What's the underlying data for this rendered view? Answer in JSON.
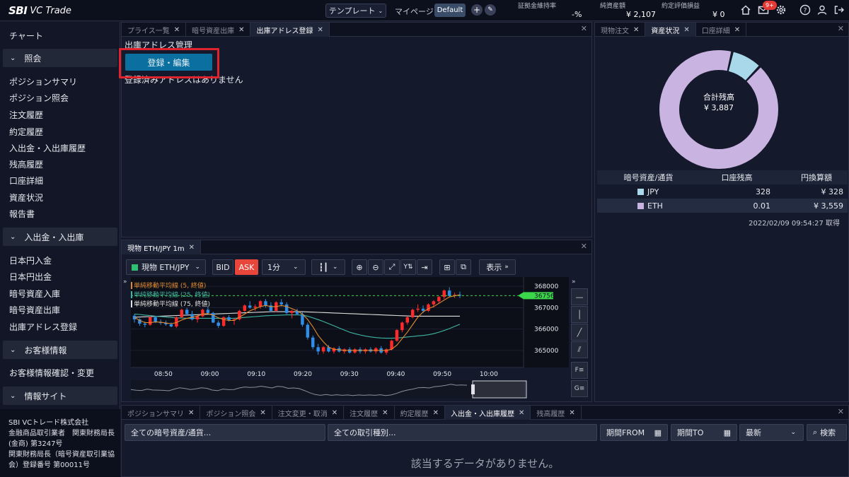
{
  "header": {
    "logo_sbi": "SBI",
    "logo_vc": "VC Trade",
    "template_label": "テンプレート",
    "mypage_label": "マイページ:",
    "default_label": "Default",
    "stats": [
      {
        "label": "証拠金維持率",
        "value": "-%"
      },
      {
        "label": "純資産額",
        "value": "¥ 2,107"
      },
      {
        "label": "約定評価損益",
        "value": "¥ 0"
      }
    ],
    "notif_badge": "9+"
  },
  "sidebar": {
    "chart_item": "チャート",
    "sections": [
      {
        "label": "照会",
        "items": [
          "ポジションサマリ",
          "ポジション照会",
          "注文履歴",
          "約定履歴",
          "入出金・入出庫履歴",
          "残高履歴",
          "口座詳細",
          "資産状況",
          "報告書"
        ]
      },
      {
        "label": "入出金・入出庫",
        "items": [
          "日本円入金",
          "日本円出金",
          "暗号資産入庫",
          "暗号資産出庫",
          "出庫アドレス登録"
        ]
      },
      {
        "label": "お客様情報",
        "items": [
          "お客様情報確認・変更"
        ]
      },
      {
        "label": "情報サイト",
        "items": []
      }
    ],
    "footer": [
      "SBI VCトレード株式会社",
      "金融商品取引業者　関東財務局長",
      "(金商) 第3247号",
      "関東財務局長（暗号資産取引業協",
      "会）登録番号 第00011号"
    ]
  },
  "top_panel": {
    "tabs": [
      {
        "label": "プライス一覧",
        "active": false
      },
      {
        "label": "暗号資産出庫",
        "active": false
      },
      {
        "label": "出庫アドレス登録",
        "active": true
      }
    ],
    "title": "出庫アドレス管理",
    "button": "登録・編集",
    "empty": "登録済みアドレスはありません"
  },
  "chart_panel": {
    "tab": "現物 ETH/JPY 1m",
    "symbol": "現物 ETH/JPY",
    "bid": "BID",
    "ask": "ASK",
    "interval": "1分",
    "display": "表示",
    "last_price": "367560",
    "legend": [
      "単純移動平均線 (5, 終値)",
      "単純移動平均線 (25, 終値)",
      "単純移動平均線 (75, 終値)"
    ],
    "legend_colors": [
      "#e08a2e",
      "#3fb5a3",
      "#e0e0e0"
    ]
  },
  "chart_data": {
    "type": "candlestick",
    "symbol": "ETH/JPY",
    "x_ticks": [
      "08:50",
      "09:00",
      "09:10",
      "09:20",
      "09:30",
      "09:40",
      "09:50",
      "10:00"
    ],
    "y_ticks": [
      368000,
      367000,
      366000,
      365000
    ],
    "ylim": [
      364300,
      368300
    ],
    "last_price": 367560,
    "candles": [
      [
        366620,
        366700,
        366300,
        366450
      ],
      [
        366450,
        366500,
        366150,
        366250
      ],
      [
        366250,
        366350,
        366080,
        366200
      ],
      [
        366200,
        366600,
        366150,
        366550
      ],
      [
        366550,
        366620,
        366280,
        366320
      ],
      [
        366320,
        366450,
        366200,
        366280
      ],
      [
        366280,
        366400,
        366150,
        366220
      ],
      [
        366220,
        366300,
        366080,
        366120
      ],
      [
        366120,
        366600,
        366050,
        366550
      ],
      [
        366550,
        366950,
        366500,
        366900
      ],
      [
        366900,
        367000,
        366650,
        366700
      ],
      [
        366700,
        366850,
        366400,
        366450
      ],
      [
        366450,
        366650,
        366300,
        366600
      ],
      [
        366600,
        366950,
        366550,
        366900
      ],
      [
        366900,
        367050,
        366700,
        366750
      ],
      [
        366750,
        366800,
        366280,
        366300
      ],
      [
        366300,
        366400,
        366050,
        366150
      ],
      [
        366150,
        366600,
        366100,
        366550
      ],
      [
        366550,
        366650,
        366350,
        366400
      ],
      [
        366400,
        366500,
        366200,
        366450
      ],
      [
        366450,
        366900,
        366400,
        366850
      ],
      [
        366850,
        367150,
        366800,
        367100
      ],
      [
        367100,
        367300,
        366950,
        367000
      ],
      [
        367000,
        367150,
        366850,
        367050
      ],
      [
        367050,
        367350,
        366950,
        367300
      ],
      [
        367300,
        367400,
        367000,
        367100
      ],
      [
        367100,
        367250,
        366800,
        366850
      ],
      [
        366850,
        367300,
        366800,
        367250
      ],
      [
        367250,
        367400,
        367050,
        367150
      ],
      [
        367150,
        367250,
        366700,
        366750
      ],
      [
        366750,
        366900,
        366500,
        366850
      ],
      [
        366850,
        366950,
        366650,
        366700
      ],
      [
        366700,
        366800,
        366100,
        366200
      ],
      [
        366200,
        366300,
        365500,
        365600
      ],
      [
        365600,
        365700,
        365050,
        365150
      ],
      [
        365150,
        365300,
        364800,
        364950
      ],
      [
        364950,
        365200,
        364850,
        365150
      ],
      [
        365150,
        365250,
        364900,
        364950
      ],
      [
        364950,
        365150,
        364850,
        365100
      ],
      [
        365100,
        365200,
        364900,
        364950
      ],
      [
        364950,
        365100,
        364850,
        365050
      ],
      [
        365050,
        365150,
        364850,
        364900
      ],
      [
        364900,
        365100,
        364850,
        365050
      ],
      [
        365050,
        365150,
        364850,
        364950
      ],
      [
        364950,
        365100,
        364850,
        365050
      ],
      [
        365050,
        365150,
        364900,
        364950
      ],
      [
        364950,
        365150,
        364850,
        365100
      ],
      [
        365100,
        365200,
        364850,
        364900
      ],
      [
        364900,
        365100,
        364800,
        365050
      ],
      [
        365050,
        365500,
        365000,
        365450
      ],
      [
        365450,
        366000,
        365400,
        365950
      ],
      [
        365950,
        366350,
        365850,
        366300
      ],
      [
        366300,
        366600,
        366200,
        366550
      ],
      [
        366550,
        366950,
        366500,
        366900
      ],
      [
        366900,
        367150,
        366800,
        366950
      ],
      [
        366950,
        367100,
        366750,
        366850
      ],
      [
        366850,
        367200,
        366800,
        367150
      ],
      [
        367150,
        367350,
        367000,
        367300
      ],
      [
        367300,
        367550,
        367200,
        367500
      ],
      [
        367500,
        367850,
        367400,
        367800
      ],
      [
        367800,
        367950,
        367500,
        367550
      ],
      [
        367550,
        367700,
        367450,
        367600
      ],
      [
        367600,
        367750,
        367450,
        367560
      ]
    ],
    "sma5": [
      366550,
      366400,
      366300,
      366300,
      366330,
      366320,
      366280,
      366250,
      366300,
      366420,
      366500,
      366550,
      366600,
      366700,
      366720,
      366650,
      366520,
      366450,
      366400,
      366400,
      366550,
      366700,
      366850,
      366950,
      367050,
      367100,
      367050,
      367050,
      367100,
      367050,
      366950,
      366850,
      366700,
      366450,
      366100,
      365700,
      365400,
      365150,
      365050,
      365030,
      365000,
      365000,
      365000,
      365000,
      365000,
      365000,
      365000,
      365000,
      365000,
      365050,
      365250,
      365550,
      365850,
      366200,
      366550,
      366800,
      366950,
      367050,
      367200,
      367350,
      367500,
      367550,
      367600
    ],
    "sma25": [
      366700,
      366680,
      366650,
      366630,
      366600,
      366580,
      366560,
      366540,
      366520,
      366510,
      366500,
      366500,
      366500,
      366500,
      366500,
      366500,
      366500,
      366500,
      366500,
      366500,
      366520,
      366540,
      366560,
      366580,
      366600,
      366620,
      366630,
      366640,
      366650,
      366660,
      366660,
      366660,
      366650,
      366600,
      366520,
      366440,
      366350,
      366250,
      366150,
      366050,
      365950,
      365850,
      365780,
      365720,
      365670,
      365630,
      365600,
      365580,
      365570,
      365570,
      365580,
      365600,
      365630,
      365650,
      365680,
      365700,
      365730,
      365780,
      365850,
      365930,
      366020,
      366120,
      366220
    ],
    "sma75": [
      366550,
      366560,
      366570,
      366580,
      366590,
      366600,
      366610,
      366620,
      366630,
      366640,
      366650,
      366660,
      366670,
      366680,
      366690,
      366700,
      366710,
      366720,
      366730,
      366740,
      366750,
      366760,
      366770,
      366780,
      366790,
      366800,
      366810,
      366810,
      366810,
      366810,
      366810,
      366810,
      366810,
      366800,
      366790,
      366780,
      366770,
      366760,
      366750,
      366740,
      366730,
      366720,
      366710,
      366700,
      366690,
      366680,
      366670,
      366660,
      366650,
      366640,
      366630,
      366620,
      366610,
      366600,
      366600,
      366600,
      366600,
      366600,
      366600,
      366600,
      366600,
      366600,
      366600
    ]
  },
  "assets_panel": {
    "tabs": [
      {
        "label": "現物注文",
        "active": false
      },
      {
        "label": "資産状況",
        "active": true
      },
      {
        "label": "口座詳細",
        "active": false
      }
    ],
    "donut_label": "合計残高",
    "donut_value": "¥ 3,887",
    "table_headers": [
      "暗号資産/通貨",
      "口座残高",
      "円換算額"
    ],
    "rows": [
      {
        "currency": "JPY",
        "balance": "328",
        "jpy": "¥ 328",
        "color": "#a8d8ea"
      },
      {
        "currency": "ETH",
        "balance": "0.01",
        "jpy": "¥ 3,559",
        "color": "#c9b3e0"
      }
    ],
    "timestamp": "2022/02/09 09:54:27 取得",
    "donut_values": [
      328,
      3559
    ]
  },
  "bottom_panel": {
    "tabs": [
      {
        "label": "ポジションサマリ",
        "active": false
      },
      {
        "label": "ポジション照会",
        "active": false
      },
      {
        "label": "注文変更・取消",
        "active": false
      },
      {
        "label": "注文履歴",
        "active": false
      },
      {
        "label": "約定履歴",
        "active": false
      },
      {
        "label": "入出金・入出庫履歴",
        "active": true
      },
      {
        "label": "残高履歴",
        "active": false
      }
    ],
    "filter_asset": "全ての暗号資産/通貨...",
    "filter_type": "全ての取引種別...",
    "from": "期間FROM",
    "to": "期間TO",
    "sort": "最新",
    "search": "検索",
    "empty": "該当するデータがありません。"
  }
}
